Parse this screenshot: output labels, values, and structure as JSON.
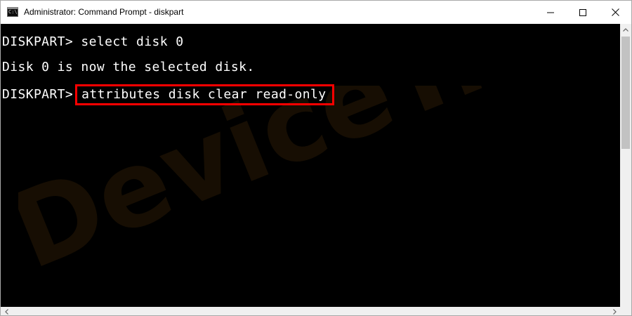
{
  "window": {
    "title": "Administrator: Command Prompt - diskpart",
    "icon": "cmd-icon",
    "buttons": {
      "minimize": "minimize-icon",
      "maximize": "maximize-icon",
      "close": "close-icon"
    }
  },
  "console": {
    "line1": {
      "prompt": "DISKPART>",
      "command": " select disk 0"
    },
    "line2": {
      "output": "Disk 0 is now the selected disk."
    },
    "line3": {
      "prompt": "DISKPART>",
      "command": "attributes disk clear read-only"
    },
    "highlight_color": "#ff0000",
    "text_color": "#ffffff",
    "background_color": "#000000"
  },
  "watermark": {
    "text": "DeviceTricks",
    "color": "#2a1a05"
  }
}
